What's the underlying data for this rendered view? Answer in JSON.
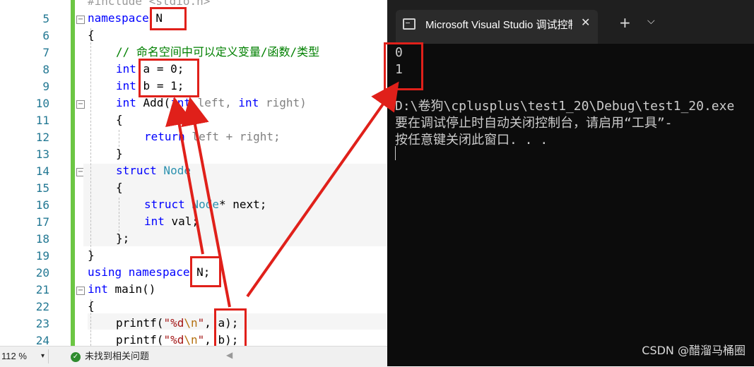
{
  "editor": {
    "line_numbers": [
      "5",
      "6",
      "7",
      "8",
      "9",
      "10",
      "11",
      "12",
      "13",
      "14",
      "15",
      "16",
      "17",
      "18",
      "19",
      "20",
      "21",
      "22",
      "23",
      "24"
    ],
    "top_partial": "#include <stdio.h>",
    "code": {
      "l5_kw": "namespace",
      "l5_name": "N",
      "l6": "{",
      "l7": "// 命名空间中可以定义变量/函数/类型",
      "l8_kw": "int",
      "l8_rest": "a = 0;",
      "l9_kw": "int",
      "l9_rest": "b = 1;",
      "l10_kw1": "int",
      "l10_fn": " Add(",
      "l10_kw2": "int",
      "l10_p1": " left, ",
      "l10_kw3": "int",
      "l10_p2": " right)",
      "l11": "{",
      "l12_kw": "return",
      "l12_rest": " left + right;",
      "l13": "}",
      "l14_kw": "struct",
      "l14_ty": " Node",
      "l15": "{",
      "l16_kw": "struct",
      "l16_ty": " Node",
      "l16_rest": "* next;",
      "l17_kw": "int",
      "l17_rest": " val;",
      "l18": "};",
      "l19": "}",
      "l20_kw1": "using",
      "l20_kw2": " namespace",
      "l20_rest": " N;",
      "l21_kw": "int",
      "l21_rest": " main()",
      "l22": "{",
      "l23_fn": "printf(",
      "l23_str": "\"%d",
      "l23_esc": "\\n",
      "l23_str2": "\"",
      "l23_rest": ", a);",
      "l24_fn": "printf(",
      "l24_str": "\"%d",
      "l24_esc": "\\n",
      "l24_str2": "\"",
      "l24_rest": ", b);"
    }
  },
  "status_bar": {
    "zoom": "112 %",
    "issues": "未找到相关问题"
  },
  "console": {
    "tab_title": "Microsoft Visual Studio 调试控制台",
    "new_tab": "+",
    "close": "✕",
    "dropdown": "⌵",
    "output_lines": [
      "0",
      "1",
      "",
      "D:\\卷狗\\cplusplus\\test1_20\\Debug\\test1_20.exe",
      "要在调试停止时自动关闭控制台，请启用“工具”-",
      "按任意键关闭此窗口. . ."
    ],
    "watermark": "CSDN @醋溜马桶圈"
  },
  "colors": {
    "keyword": "#0000ff",
    "type": "#2b91af",
    "comment": "#008000",
    "string": "#a31515",
    "annotation": "#e0201a",
    "console_bg": "#0c0c0c"
  }
}
